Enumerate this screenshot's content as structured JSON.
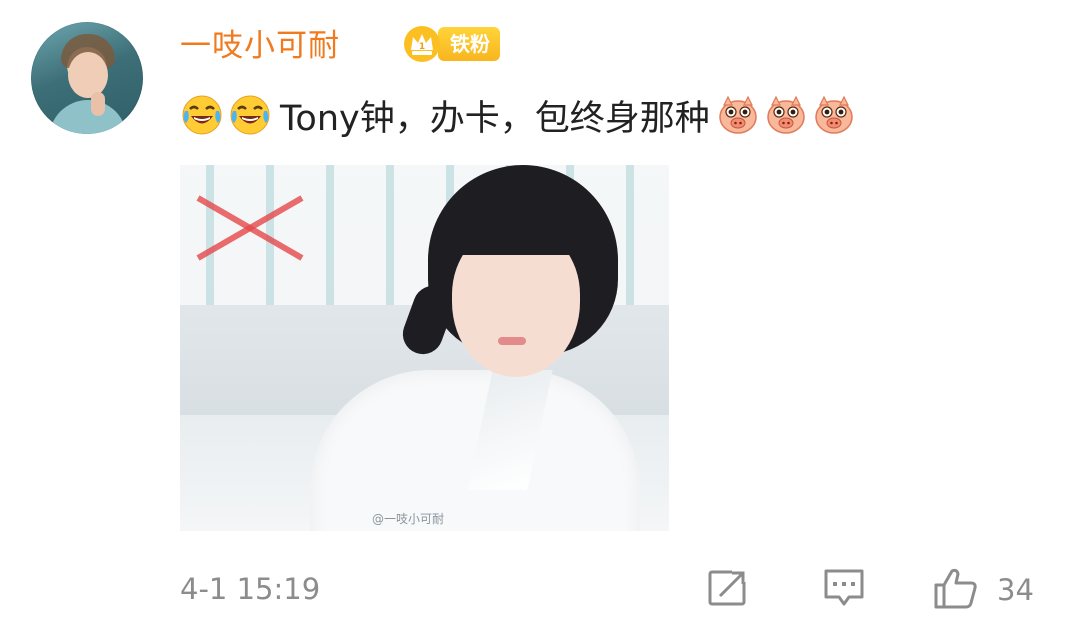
{
  "comment": {
    "username": "一吱小可耐",
    "badge_label": "铁粉",
    "text": "Tony钟，办卡，包终身那种",
    "leading_emojis": [
      "laughing-tears-icon",
      "laughing-tears-icon"
    ],
    "trailing_emojis": [
      "pig-face-icon",
      "pig-face-icon",
      "pig-face-icon"
    ],
    "image_watermark": "@一吱小可耐",
    "timestamp": "4-1 15:19",
    "like_count": "34"
  },
  "colors": {
    "username": "#f07a1e",
    "badge": "#f8b51e",
    "text": "#222222",
    "meta": "#8c8c8c",
    "icon": "#8c8c8c"
  }
}
